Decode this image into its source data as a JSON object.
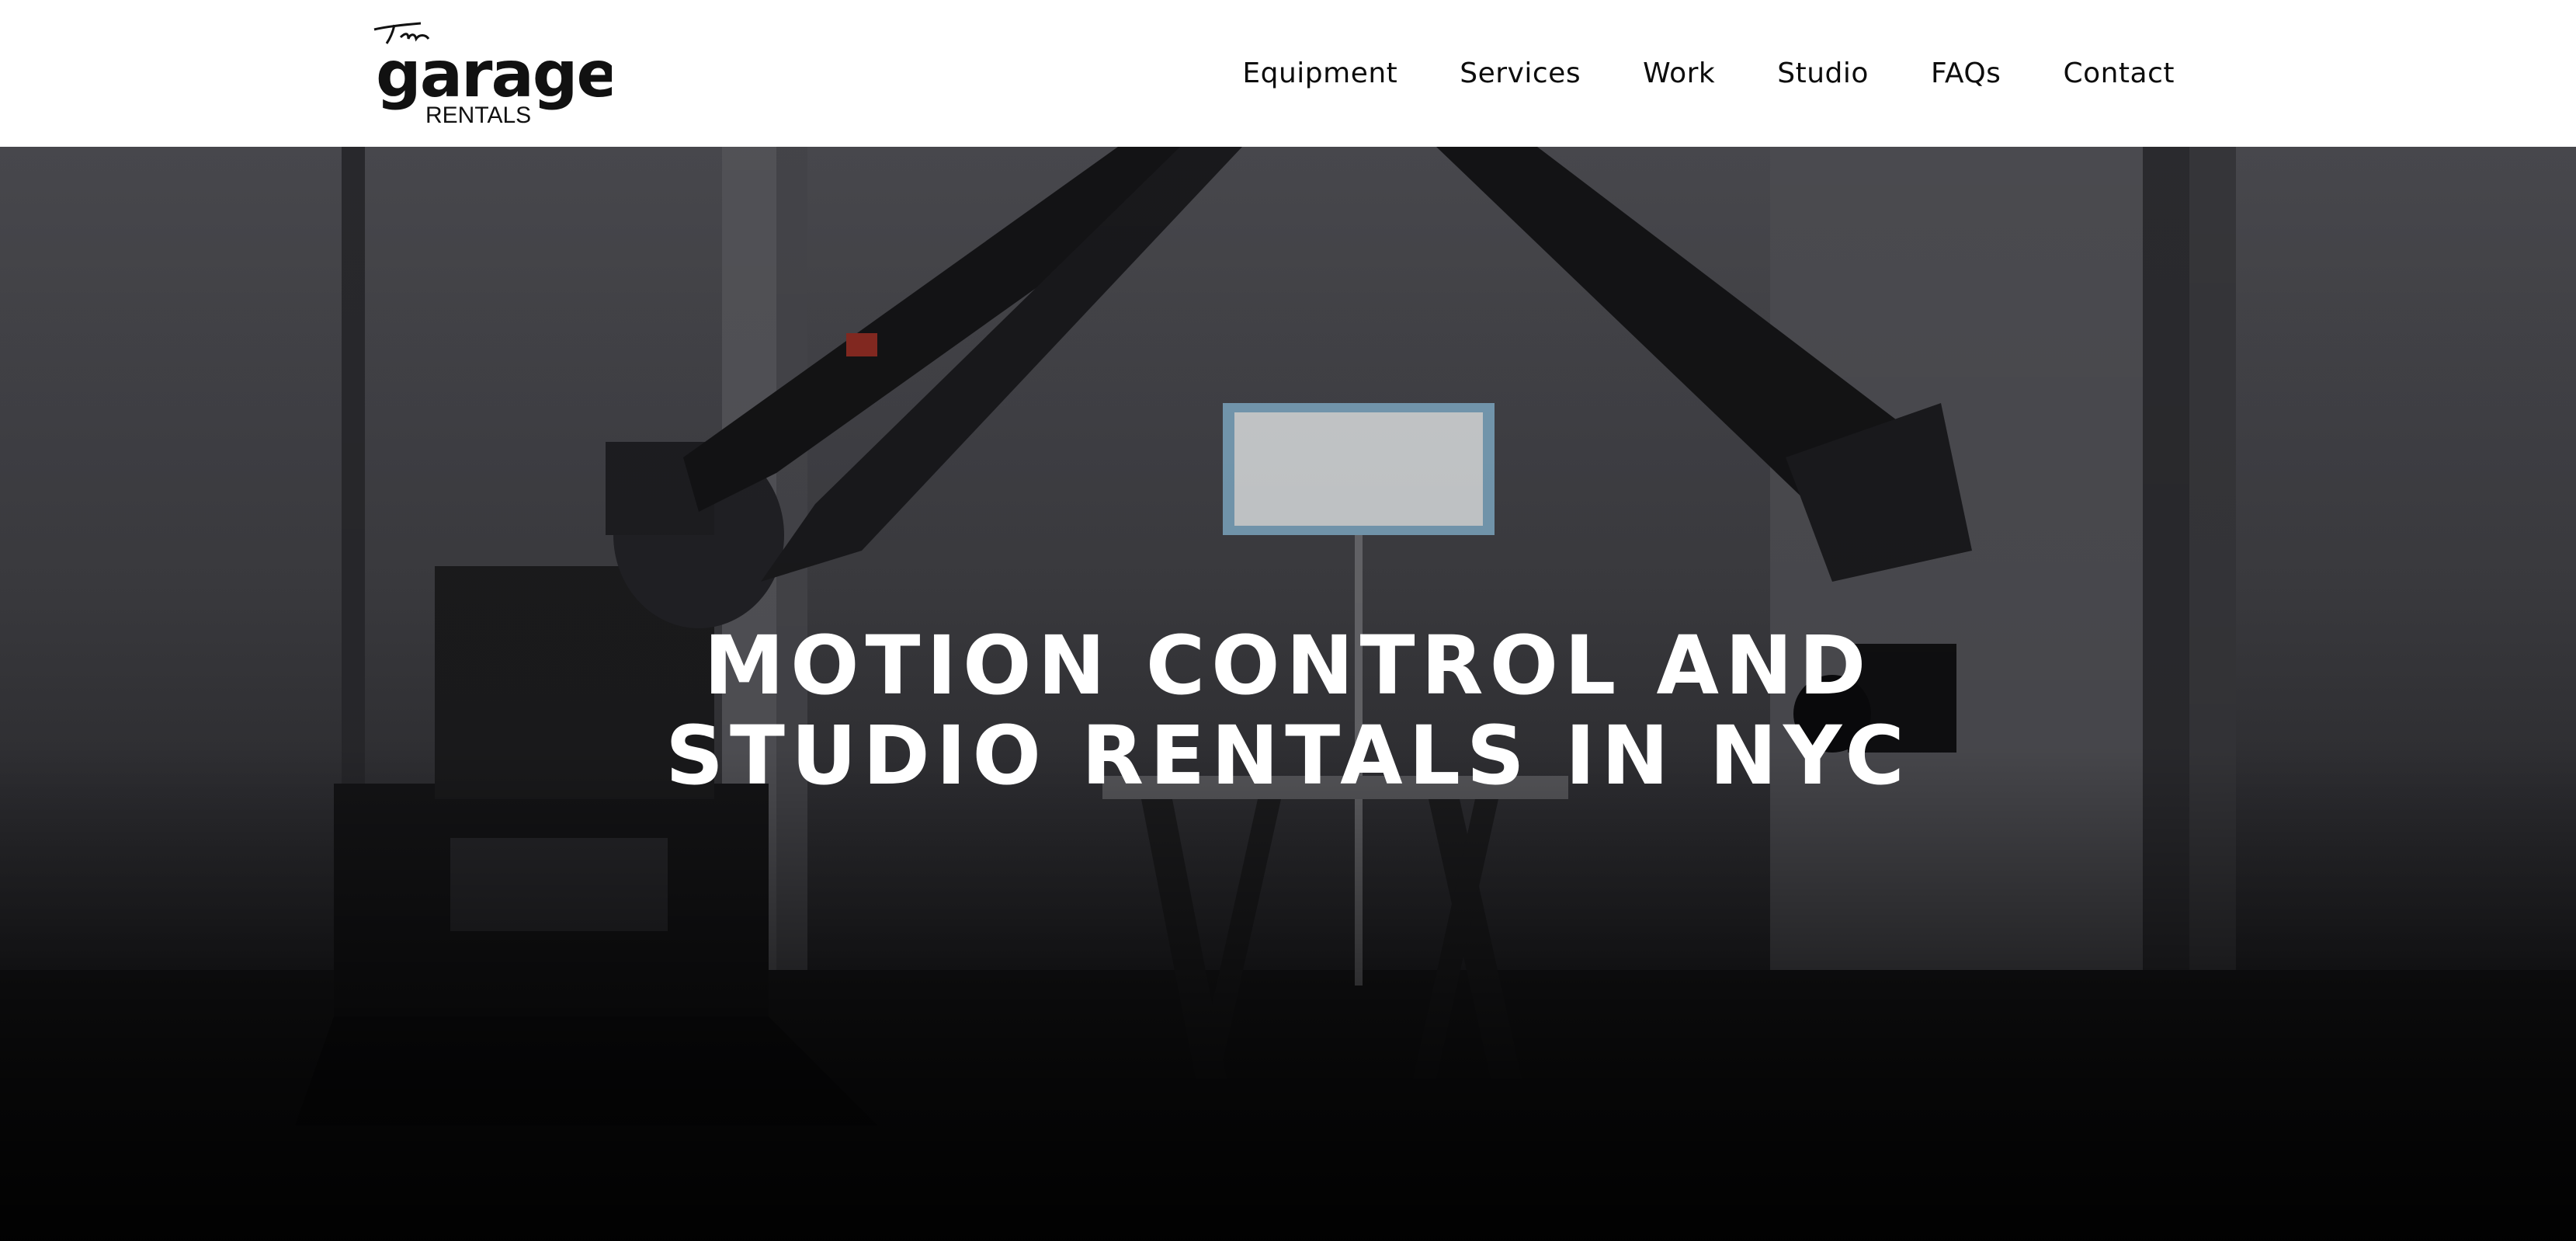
{
  "header": {
    "logo": {
      "script": "The",
      "word": "garage",
      "sub": "RENTALS"
    },
    "nav": [
      {
        "label": "Equipment"
      },
      {
        "label": "Services"
      },
      {
        "label": "Work"
      },
      {
        "label": "Studio"
      },
      {
        "label": "FAQs"
      },
      {
        "label": "Contact"
      }
    ]
  },
  "hero": {
    "headline_line1": "MOTION CONTROL AND",
    "headline_line2": "STUDIO RENTALS IN NYC"
  },
  "colors": {
    "header_bg": "#ffffff",
    "nav_text": "#0d0d0d",
    "headline": "#ffffff"
  },
  "icons": {
    "logo": "garage-rentals-logo"
  }
}
